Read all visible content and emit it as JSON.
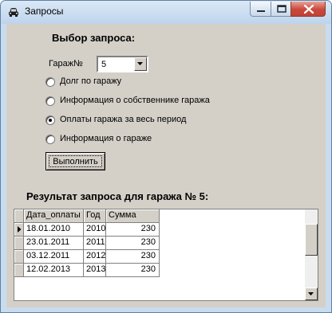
{
  "window": {
    "title": "Запросы"
  },
  "form": {
    "heading": "Выбор запроса:",
    "garage_label": "Гараж№",
    "garage_value": "5",
    "options": [
      {
        "label": "Долг по гаражу",
        "selected": false
      },
      {
        "label": "Информация о собственнике гаража",
        "selected": false
      },
      {
        "label": "Оплаты гаража за весь период",
        "selected": true
      },
      {
        "label": "Информация о гараже",
        "selected": false
      }
    ],
    "run_label": "Выполнить"
  },
  "result": {
    "heading": "Результат запроса для гаража № 5:",
    "columns": [
      "Дата_оплаты",
      "Год",
      "Сумма"
    ],
    "rows": [
      [
        "18.01.2010",
        "2010",
        "230"
      ],
      [
        "23.01.2011",
        "2011",
        "230"
      ],
      [
        "03.12.2011",
        "2012",
        "230"
      ],
      [
        "12.02.2013",
        "2013",
        "230"
      ]
    ],
    "current_row": 0
  },
  "icons": {
    "app": "car-icon",
    "minimize": "minimize-icon",
    "maximize": "maximize-icon",
    "close": "close-icon",
    "combo": "chevron-down-icon",
    "record": "record-pointer-icon"
  },
  "colors": {
    "face": "#d4d0c8",
    "frame": "#c9dcef",
    "close": "#c9493b"
  }
}
